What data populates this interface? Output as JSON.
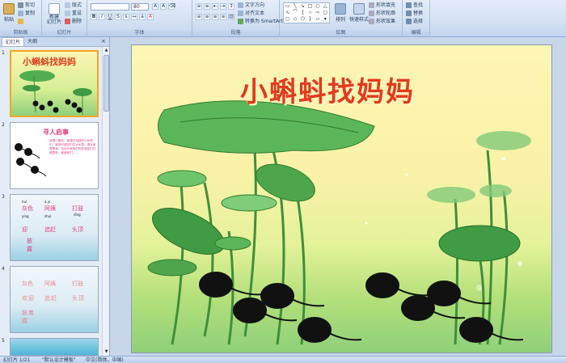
{
  "ribbon": {
    "clipboard": {
      "paste": "粘贴",
      "cut": "剪切",
      "copy": "复制",
      "format_painter": "格式刷",
      "label": "剪贴板"
    },
    "slides": {
      "new_slide": "新建\n幻灯片",
      "layout": "版式",
      "reset": "重设",
      "delete": "删除",
      "label": "幻灯片"
    },
    "font": {
      "font_name": "",
      "font_size": "80",
      "label": "字体"
    },
    "paragraph": {
      "text_direction": "文字方向",
      "align_text": "对齐文本",
      "smartart": "转换为 SmartArt",
      "label": "段落"
    },
    "drawing": {
      "arrange": "排列",
      "quick_styles": "快速样式",
      "shape_fill": "形状填充",
      "shape_outline": "形状轮廓",
      "shape_effects": "形状效果",
      "label": "绘图"
    },
    "editing": {
      "find": "查找",
      "replace": "替换",
      "select": "选择",
      "label": "编辑"
    }
  },
  "left_pane": {
    "tabs": [
      "幻灯片",
      "大纲"
    ],
    "close": "×",
    "slides": [
      {
        "num": "1",
        "title": "小蝌蚪找妈妈"
      },
      {
        "num": "2",
        "title": "寻人启事",
        "body": "我是小蝌蚪，我想去找我的小伙伴们，我的好朋友们在大水里，请大家帮帮我，告诉大家我们的好朋友们在哪里呀。谢谢你们……"
      },
      {
        "num": "3",
        "pinyin": [
          "huī",
          "ā yí",
          "dǐng",
          "yíng",
          "zhuī",
          "kuān",
          "pì",
          "lù"
        ],
        "words": [
          "灰色",
          "阿姨",
          "打鼓",
          "迎",
          "追赶",
          "头顶",
          "披",
          "露"
        ]
      },
      {
        "num": "4",
        "words": [
          "灰色",
          "阿姨",
          "打鼓",
          "欢",
          "迎",
          "追",
          "赶",
          "头",
          "顶",
          "披",
          "着",
          "露"
        ]
      },
      {
        "num": "5"
      }
    ]
  },
  "slide": {
    "title": "小蝌蚪找妈妈"
  },
  "status_bar": {
    "slide_info": "幻灯片 1/21",
    "theme": "\"默认设计模板\"",
    "language": "中文(简体，中国)"
  },
  "colors": {
    "title_red": "#e33b1c",
    "selected_border": "#f5a623",
    "ribbon_bg": "#d3e1f3"
  }
}
